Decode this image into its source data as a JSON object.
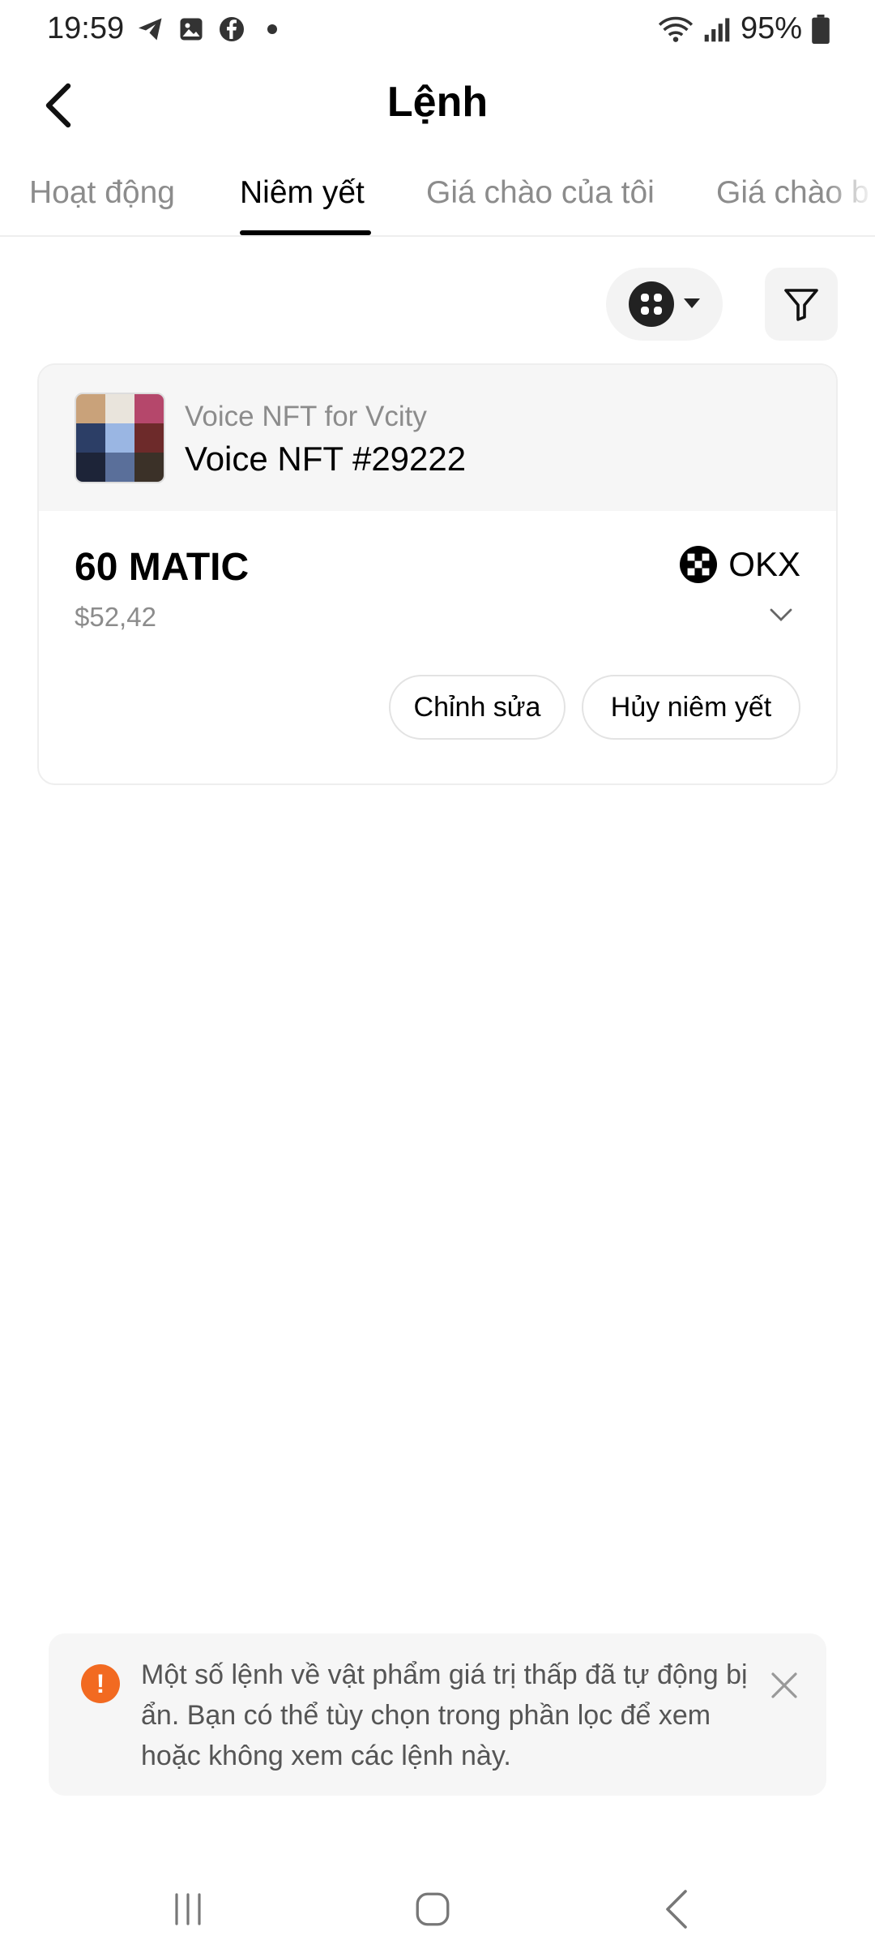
{
  "status_bar": {
    "time": "19:59",
    "battery": "95%",
    "icons_left": [
      "telegram-icon",
      "gallery-icon",
      "facebook-icon",
      "dot-icon"
    ],
    "icons_right": [
      "wifi-icon",
      "signal-icon",
      "battery-icon"
    ]
  },
  "header": {
    "title": "Lệnh"
  },
  "tabs": [
    {
      "label": "Hoạt động",
      "active": false
    },
    {
      "label": "Niêm yết",
      "active": true
    },
    {
      "label": "Giá chào của tôi",
      "active": false
    },
    {
      "label": "Giá chào b",
      "active": false
    }
  ],
  "toolbar": {
    "chain_icon": "grid-icon",
    "filter_icon": "filter-icon"
  },
  "listing": {
    "collection": "Voice NFT for Vcity",
    "name": "Voice NFT #29222",
    "price": "60 MATIC",
    "price_usd": "$52,42",
    "marketplace": "OKX",
    "edit_label": "Chỉnh sửa",
    "unlist_label": "Hủy niêm yết"
  },
  "notice": {
    "text": "Một số lệnh về vật phẩm giá trị thấp đã tự động bị ẩn. Bạn có thể tùy chọn trong phần lọc để xem hoặc không xem các lệnh này.",
    "accent": "#f26a21"
  }
}
